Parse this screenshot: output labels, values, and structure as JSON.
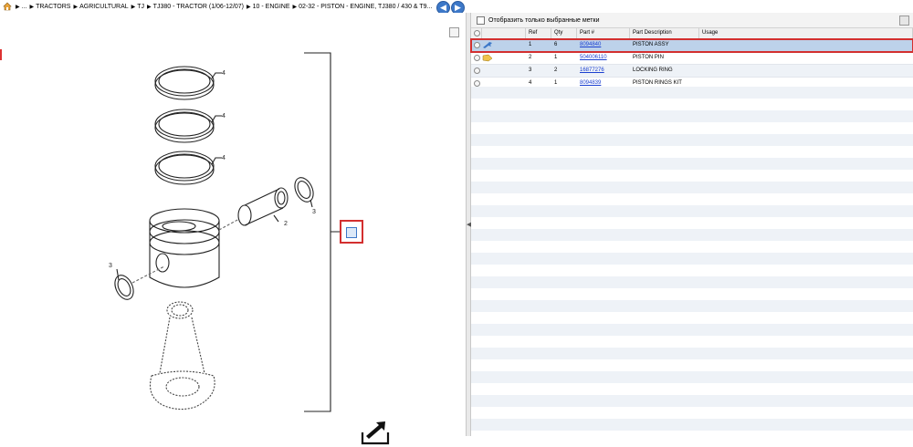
{
  "breadcrumb": {
    "items": [
      "...",
      "TRACTORS",
      "AGRICULTURAL",
      "TJ",
      "TJ380 - TRACTOR (1/06-12/07)",
      "10 - ENGINE",
      "02-32 - PISTON - ENGINE, TJ380 / 430 & T9..."
    ]
  },
  "filter": {
    "label": "Отобразить только выбранные метки"
  },
  "table": {
    "headers": {
      "ref": "Ref",
      "qty": "Qty",
      "part": "Part #",
      "desc": "Part Description",
      "usage": "Usage"
    },
    "rows": [
      {
        "ref": "1",
        "qty": "6",
        "part": "8094840",
        "desc": "PISTON ASSY",
        "usage": "",
        "icon": "wrench-icon"
      },
      {
        "ref": "2",
        "qty": "1",
        "part": "504006110",
        "desc": "PISTON PIN",
        "usage": "",
        "icon": "tag-icon"
      },
      {
        "ref": "3",
        "qty": "2",
        "part": "16877276",
        "desc": "LOCKING RING",
        "usage": "",
        "icon": ""
      },
      {
        "ref": "4",
        "qty": "1",
        "part": "8094839",
        "desc": "PISTON RINGS KIT",
        "usage": "",
        "icon": ""
      }
    ]
  },
  "diagram": {
    "callouts": [
      "4",
      "4",
      "4",
      "3",
      "2",
      "3"
    ]
  },
  "colors": {
    "accent": "#3d78c8",
    "highlight": "#d32f2f",
    "selected_row": "#bdd2ea"
  }
}
